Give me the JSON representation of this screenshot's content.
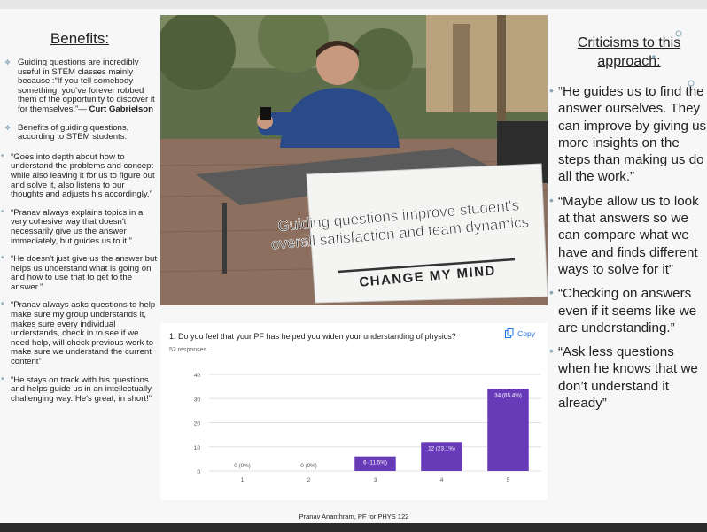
{
  "left": {
    "title": "Benefits:",
    "items": [
      {
        "text": "Guiding questions are incredibly useful in STEM classes mainly because :“If you tell somebody something, you’ve forever robbed them of the opportunity to discover it for themselves.”— ",
        "bold": "Curt Gabrielson",
        "style": "diamond"
      },
      {
        "text": "Benefits of guiding questions, according to STEM students:",
        "bold": "",
        "style": "diamond"
      },
      {
        "text": "“Goes into depth about how to understand the problems and concept while also leaving it for us to figure out and solve it, also listens to our thoughts and adjusts his accordingly.”",
        "bold": "",
        "style": "dot"
      },
      {
        "text": "“Pranav always explains topics in a very cohesive way that doesn't necessarily give us the answer immediately, but guides us to it.”",
        "bold": "",
        "style": "dot"
      },
      {
        "text": "“He doesn't just give us the answer but helps us understand what is going on and how to use that to get to the answer.”",
        "bold": "",
        "style": "dot"
      },
      {
        "text": "“Pranav always asks questions to help make sure my group understands it, makes sure every individual understands, check in to see if we need help, will check previous work to make sure we understand the current content”",
        "bold": "",
        "style": "dot"
      },
      {
        "text": "“He stays on track with his questions and helps guide us in an intellectually challenging way. He's great, in short!”",
        "bold": "",
        "style": "dot"
      }
    ]
  },
  "meme": {
    "sign_caption_line1": "Guiding questions improve student's",
    "sign_caption_line2": "overall satisfaction and team dynamics",
    "sign_text": "CHANGE MY MIND"
  },
  "form": {
    "question": "1. Do you feel that your PF has helped you widen your understanding of physics?",
    "responses": "52 responses",
    "copy_label": "Copy",
    "icon": "copy-icon",
    "accent": "#1a73e8"
  },
  "chart_data": {
    "type": "bar",
    "categories": [
      "1",
      "2",
      "3",
      "4",
      "5"
    ],
    "values": [
      0,
      0,
      6,
      12,
      34
    ],
    "data_labels": [
      "0 (0%)",
      "0 (0%)",
      "6 (11.5%)",
      "12 (23.1%)",
      "34 (65.4%)"
    ],
    "yticks": [
      "0",
      "10",
      "20",
      "30",
      "40"
    ],
    "ylim": [
      0,
      40
    ],
    "bar_color": "#673ab7",
    "grid": true
  },
  "caption": "Pranav Ananthram, PF for PHYS 122",
  "right": {
    "title": "Criticisms to this approach:",
    "items": [
      "“He guides us to find the answer ourselves. They can improve by giving us more insights on the steps than making us do all the work.”",
      "“Maybe allow us to look at that answers so we can compare what we have and finds different ways to solve for it”",
      "“Checking on answers even if it seems like we are understanding.”",
      "“Ask less questions when he knows that we don’t understand it already”"
    ]
  }
}
